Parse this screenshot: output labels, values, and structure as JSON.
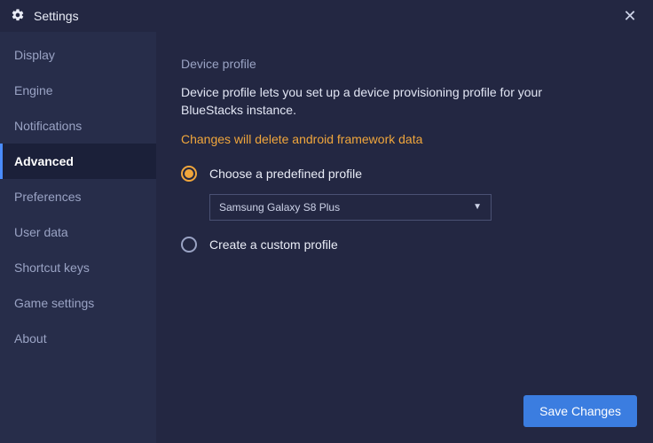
{
  "window": {
    "title": "Settings"
  },
  "sidebar": {
    "items": [
      {
        "label": "Display",
        "active": false
      },
      {
        "label": "Engine",
        "active": false
      },
      {
        "label": "Notifications",
        "active": false
      },
      {
        "label": "Advanced",
        "active": true
      },
      {
        "label": "Preferences",
        "active": false
      },
      {
        "label": "User data",
        "active": false
      },
      {
        "label": "Shortcut keys",
        "active": false
      },
      {
        "label": "Game settings",
        "active": false
      },
      {
        "label": "About",
        "active": false
      }
    ]
  },
  "main": {
    "section_title": "Device profile",
    "description": "Device profile lets you set up a device provisioning profile for your BlueStacks instance.",
    "warning": "Changes will delete android framework data",
    "option_predefined": "Choose a predefined profile",
    "option_custom": "Create a custom profile",
    "selected_profile": "Samsung Galaxy S8 Plus"
  },
  "footer": {
    "save_label": "Save Changes"
  }
}
